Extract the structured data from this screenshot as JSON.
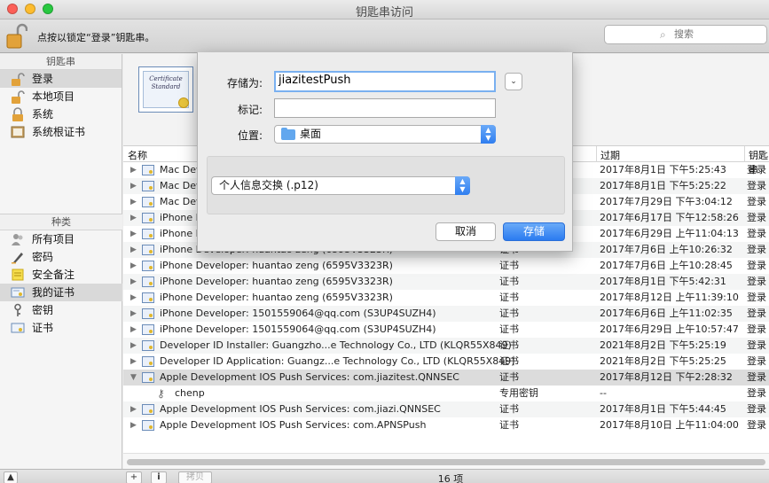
{
  "window": {
    "title": "钥匙串访问"
  },
  "toolbar": {
    "lock_hint": "点按以锁定“登录”钥匙串。",
    "search_placeholder": "搜索"
  },
  "sidebar": {
    "keychains_title": "钥匙串",
    "keychains": [
      {
        "label": "登录",
        "icon": "unlocked-padlock-icon",
        "selected": true
      },
      {
        "label": "本地项目",
        "icon": "unlocked-padlock-icon",
        "selected": false
      },
      {
        "label": "系统",
        "icon": "padlock-icon",
        "selected": false
      },
      {
        "label": "系统根证书",
        "icon": "cabinet-icon",
        "selected": false
      }
    ],
    "categories_title": "种类",
    "categories": [
      {
        "label": "所有项目",
        "icon": "people-icon",
        "selected": false
      },
      {
        "label": "密码",
        "icon": "pencil-icon",
        "selected": false
      },
      {
        "label": "安全备注",
        "icon": "note-icon",
        "selected": false
      },
      {
        "label": "我的证书",
        "icon": "my-certificate-icon",
        "selected": true
      },
      {
        "label": "密钥",
        "icon": "key-icon",
        "selected": false
      },
      {
        "label": "证书",
        "icon": "certificate-icon",
        "selected": false
      }
    ]
  },
  "detail": {
    "cert_thumb_line1": "Certificate",
    "cert_thumb_line2": "Standard"
  },
  "table": {
    "headers": {
      "name": "名称",
      "expires": "过期",
      "keychain": "钥匙串"
    },
    "rows": [
      {
        "name": "Mac Developer",
        "kind": "",
        "expires": "2017年8月1日 下午5:25:43",
        "keychain": "登录"
      },
      {
        "name": "Mac Developer",
        "kind": "",
        "expires": "2017年8月1日 下午5:25:22",
        "keychain": "登录"
      },
      {
        "name": "Mac Developer",
        "kind": "",
        "expires": "2017年7月29日 下午3:04:12",
        "keychain": "登录"
      },
      {
        "name": "iPhone Developer",
        "kind": "",
        "expires": "2017年6月17日 下午12:58:26",
        "keychain": "登录"
      },
      {
        "name": "iPhone Developer",
        "kind": "",
        "expires": "2017年6月29日 上午11:04:13",
        "keychain": "登录"
      },
      {
        "name": "iPhone Developer: huantao zeng (6595V3323R)",
        "kind": "证书",
        "expires": "2017年7月6日 上午10:26:32",
        "keychain": "登录"
      },
      {
        "name": "iPhone Developer: huantao zeng (6595V3323R)",
        "kind": "证书",
        "expires": "2017年7月6日 上午10:28:45",
        "keychain": "登录"
      },
      {
        "name": "iPhone Developer: huantao zeng (6595V3323R)",
        "kind": "证书",
        "expires": "2017年8月1日 下午5:42:31",
        "keychain": "登录"
      },
      {
        "name": "iPhone Developer: huantao zeng (6595V3323R)",
        "kind": "证书",
        "expires": "2017年8月12日 上午11:39:10",
        "keychain": "登录"
      },
      {
        "name": "iPhone Developer: 1501559064@qq.com (S3UP4SUZH4)",
        "kind": "证书",
        "expires": "2017年6月6日 上午11:02:35",
        "keychain": "登录"
      },
      {
        "name": "iPhone Developer: 1501559064@qq.com (S3UP4SUZH4)",
        "kind": "证书",
        "expires": "2017年6月29日 上午10:57:47",
        "keychain": "登录"
      },
      {
        "name": "Developer ID Installer: Guangzho...e Technology Co., LTD (KLQR55X849)",
        "kind": "证书",
        "expires": "2021年8月2日 下午5:25:19",
        "keychain": "登录"
      },
      {
        "name": "Developer ID Application: Guangz...e Technology Co., LTD (KLQR55X849)",
        "kind": "证书",
        "expires": "2021年8月2日 下午5:25:25",
        "keychain": "登录"
      },
      {
        "name": "Apple Development IOS Push Services: com.jiazitest.QNNSEC",
        "kind": "证书",
        "expires": "2017年8月12日 下午2:28:32",
        "keychain": "登录"
      },
      {
        "name": "chenp",
        "kind": "专用密钥",
        "expires": "--",
        "keychain": "登录"
      },
      {
        "name": "Apple Development IOS Push Services: com.jiazi.QNNSEC",
        "kind": "证书",
        "expires": "2017年8月1日 下午5:44:45",
        "keychain": "登录"
      },
      {
        "name": "Apple Development IOS Push Services: com.APNSPush",
        "kind": "证书",
        "expires": "2017年8月10日 上午11:04:00",
        "keychain": "登录"
      }
    ]
  },
  "status": {
    "count": "16 项",
    "add": "+",
    "info": "i",
    "copy": "拷贝"
  },
  "save_sheet": {
    "save_as_label": "存储为:",
    "save_as_value": "jiazitestPush",
    "tags_label": "标记:",
    "tags_value": "",
    "location_label": "位置:",
    "location_value": "桌面",
    "format_value": "个人信息交换 (.p12)",
    "cancel_label": "取消",
    "save_label": "存储"
  },
  "colors": {
    "accent": "#2f7ef0",
    "folder": "#62a7ee"
  }
}
